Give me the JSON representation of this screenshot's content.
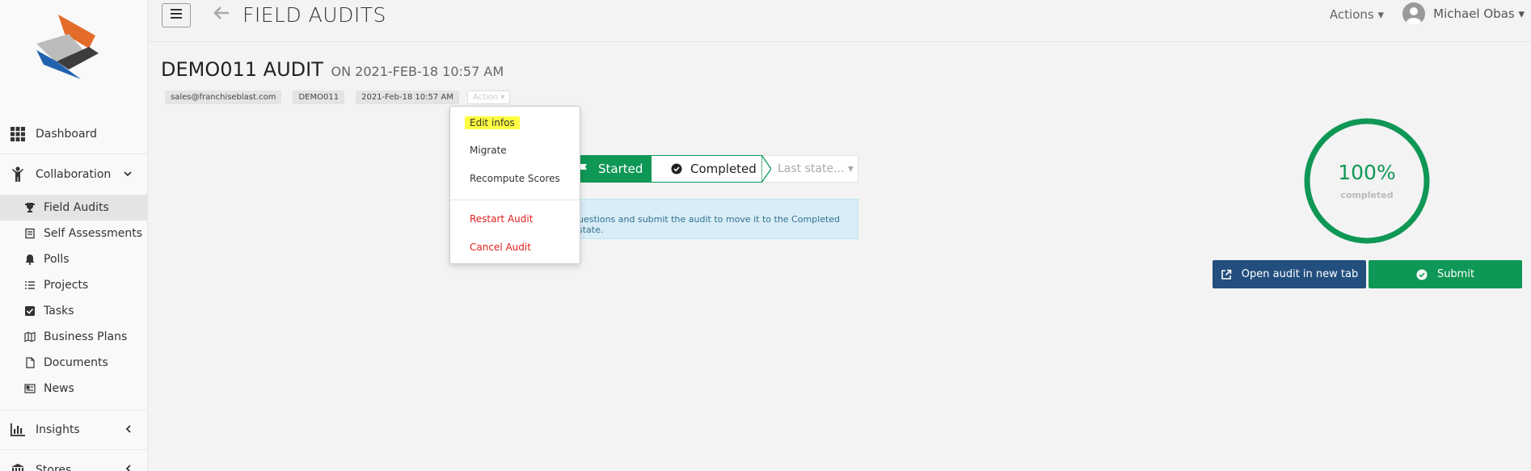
{
  "header": {
    "title": "FIELD AUDITS",
    "actions_label": "Actions ▾",
    "user_name": "Michael Obas ▾"
  },
  "sidebar": {
    "items": [
      {
        "label": "Dashboard"
      },
      {
        "label": "Collaboration"
      },
      {
        "label": "Insights"
      },
      {
        "label": "Stores"
      }
    ],
    "sub_items": [
      {
        "label": "Field Audits"
      },
      {
        "label": "Self Assessments"
      },
      {
        "label": "Polls"
      },
      {
        "label": "Projects"
      },
      {
        "label": "Tasks"
      },
      {
        "label": "Business Plans"
      },
      {
        "label": "Documents"
      },
      {
        "label": "News"
      }
    ]
  },
  "audit": {
    "title": "DEMO011 AUDIT",
    "subtitle": "ON 2021-FEB-18 10:57 AM",
    "tags": [
      "sales@franchiseblast.com",
      "DEMO011",
      "2021-Feb-18 10:57 AM"
    ],
    "action_tag": "Action ▾"
  },
  "dropdown": {
    "items": [
      "Edit infos",
      "Migrate",
      "Recompute Scores"
    ],
    "danger_items": [
      "Restart Audit",
      "Cancel Audit"
    ]
  },
  "steps": {
    "started": "Started",
    "completed": "Completed",
    "last": "Last state... ▾"
  },
  "info": {
    "text": "uestions and submit the audit to move it to the Completed state."
  },
  "progress": {
    "percent_text": "100%",
    "value": 1.0,
    "label": "completed",
    "color": "#0f9755"
  },
  "buttons": {
    "open": "Open audit in new tab",
    "submit": "Submit"
  }
}
